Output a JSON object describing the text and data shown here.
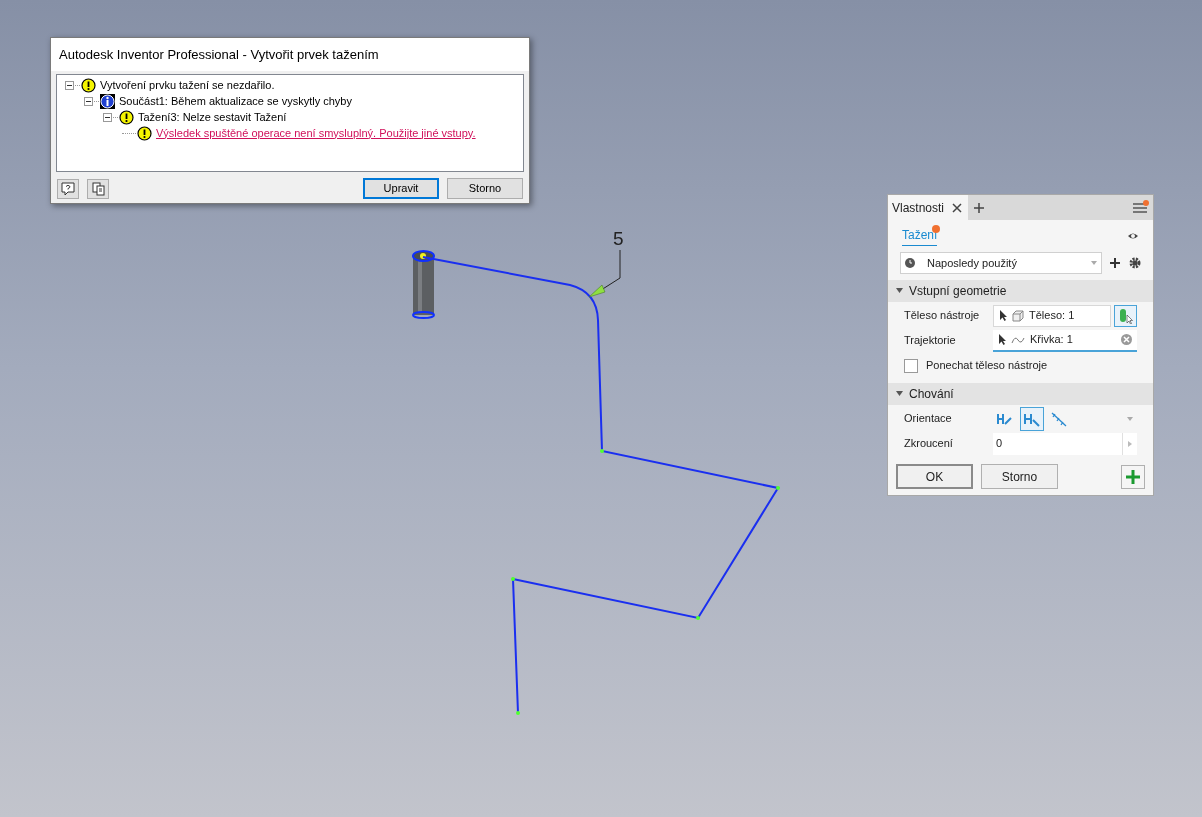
{
  "dialog": {
    "title": "Autodesk Inventor Professional - Vytvořit prvek tažením",
    "tree": [
      {
        "kind": "warning",
        "text": "Vytvoření prvku tažení se nezdařilo.",
        "expanded": true,
        "children": [
          {
            "kind": "info",
            "text": "Součást1: Během aktualizace se vyskytly chyby",
            "expanded": true,
            "children": [
              {
                "kind": "warning",
                "text": "Tažení3: Nelze sestavit Tažení",
                "expanded": true,
                "children": [
                  {
                    "kind": "warning-link",
                    "text": "Výsledek spuštěné operace není smysluplný. Použijte jiné vstupy."
                  }
                ]
              }
            ]
          }
        ]
      }
    ],
    "buttons": [
      {
        "label": "Upravit",
        "selected": true
      },
      {
        "label": "Storno",
        "selected": false
      }
    ]
  },
  "viewport": {
    "dimension_label": "5"
  },
  "panel": {
    "tab": "Vlastnosti",
    "feature_tab": {
      "label": "Tažení",
      "selected": true
    },
    "preset": "Naposledy použitý",
    "sections": [
      {
        "title": "Vstupní geometrie",
        "expanded": true,
        "rows": [
          {
            "kind": "select",
            "label": "Těleso nástroje",
            "value": "Těleso: 1",
            "active": false
          },
          {
            "kind": "select",
            "label": "Trajektorie",
            "value": "Křivka: 1",
            "active": true
          },
          {
            "kind": "checkbox",
            "label": "Ponechat těleso nástroje",
            "checked": false
          }
        ]
      },
      {
        "title": "Chování",
        "expanded": true,
        "rows": [
          {
            "kind": "orientation",
            "label": "Orientace",
            "options": [
              {
                "selected": false
              },
              {
                "selected": true
              },
              {
                "selected": false
              }
            ]
          },
          {
            "kind": "number",
            "label": "Zkroucení",
            "value": "0"
          }
        ]
      }
    ],
    "buttons": [
      {
        "label": "OK",
        "selected": true
      },
      {
        "label": "Storno",
        "selected": false
      }
    ]
  }
}
